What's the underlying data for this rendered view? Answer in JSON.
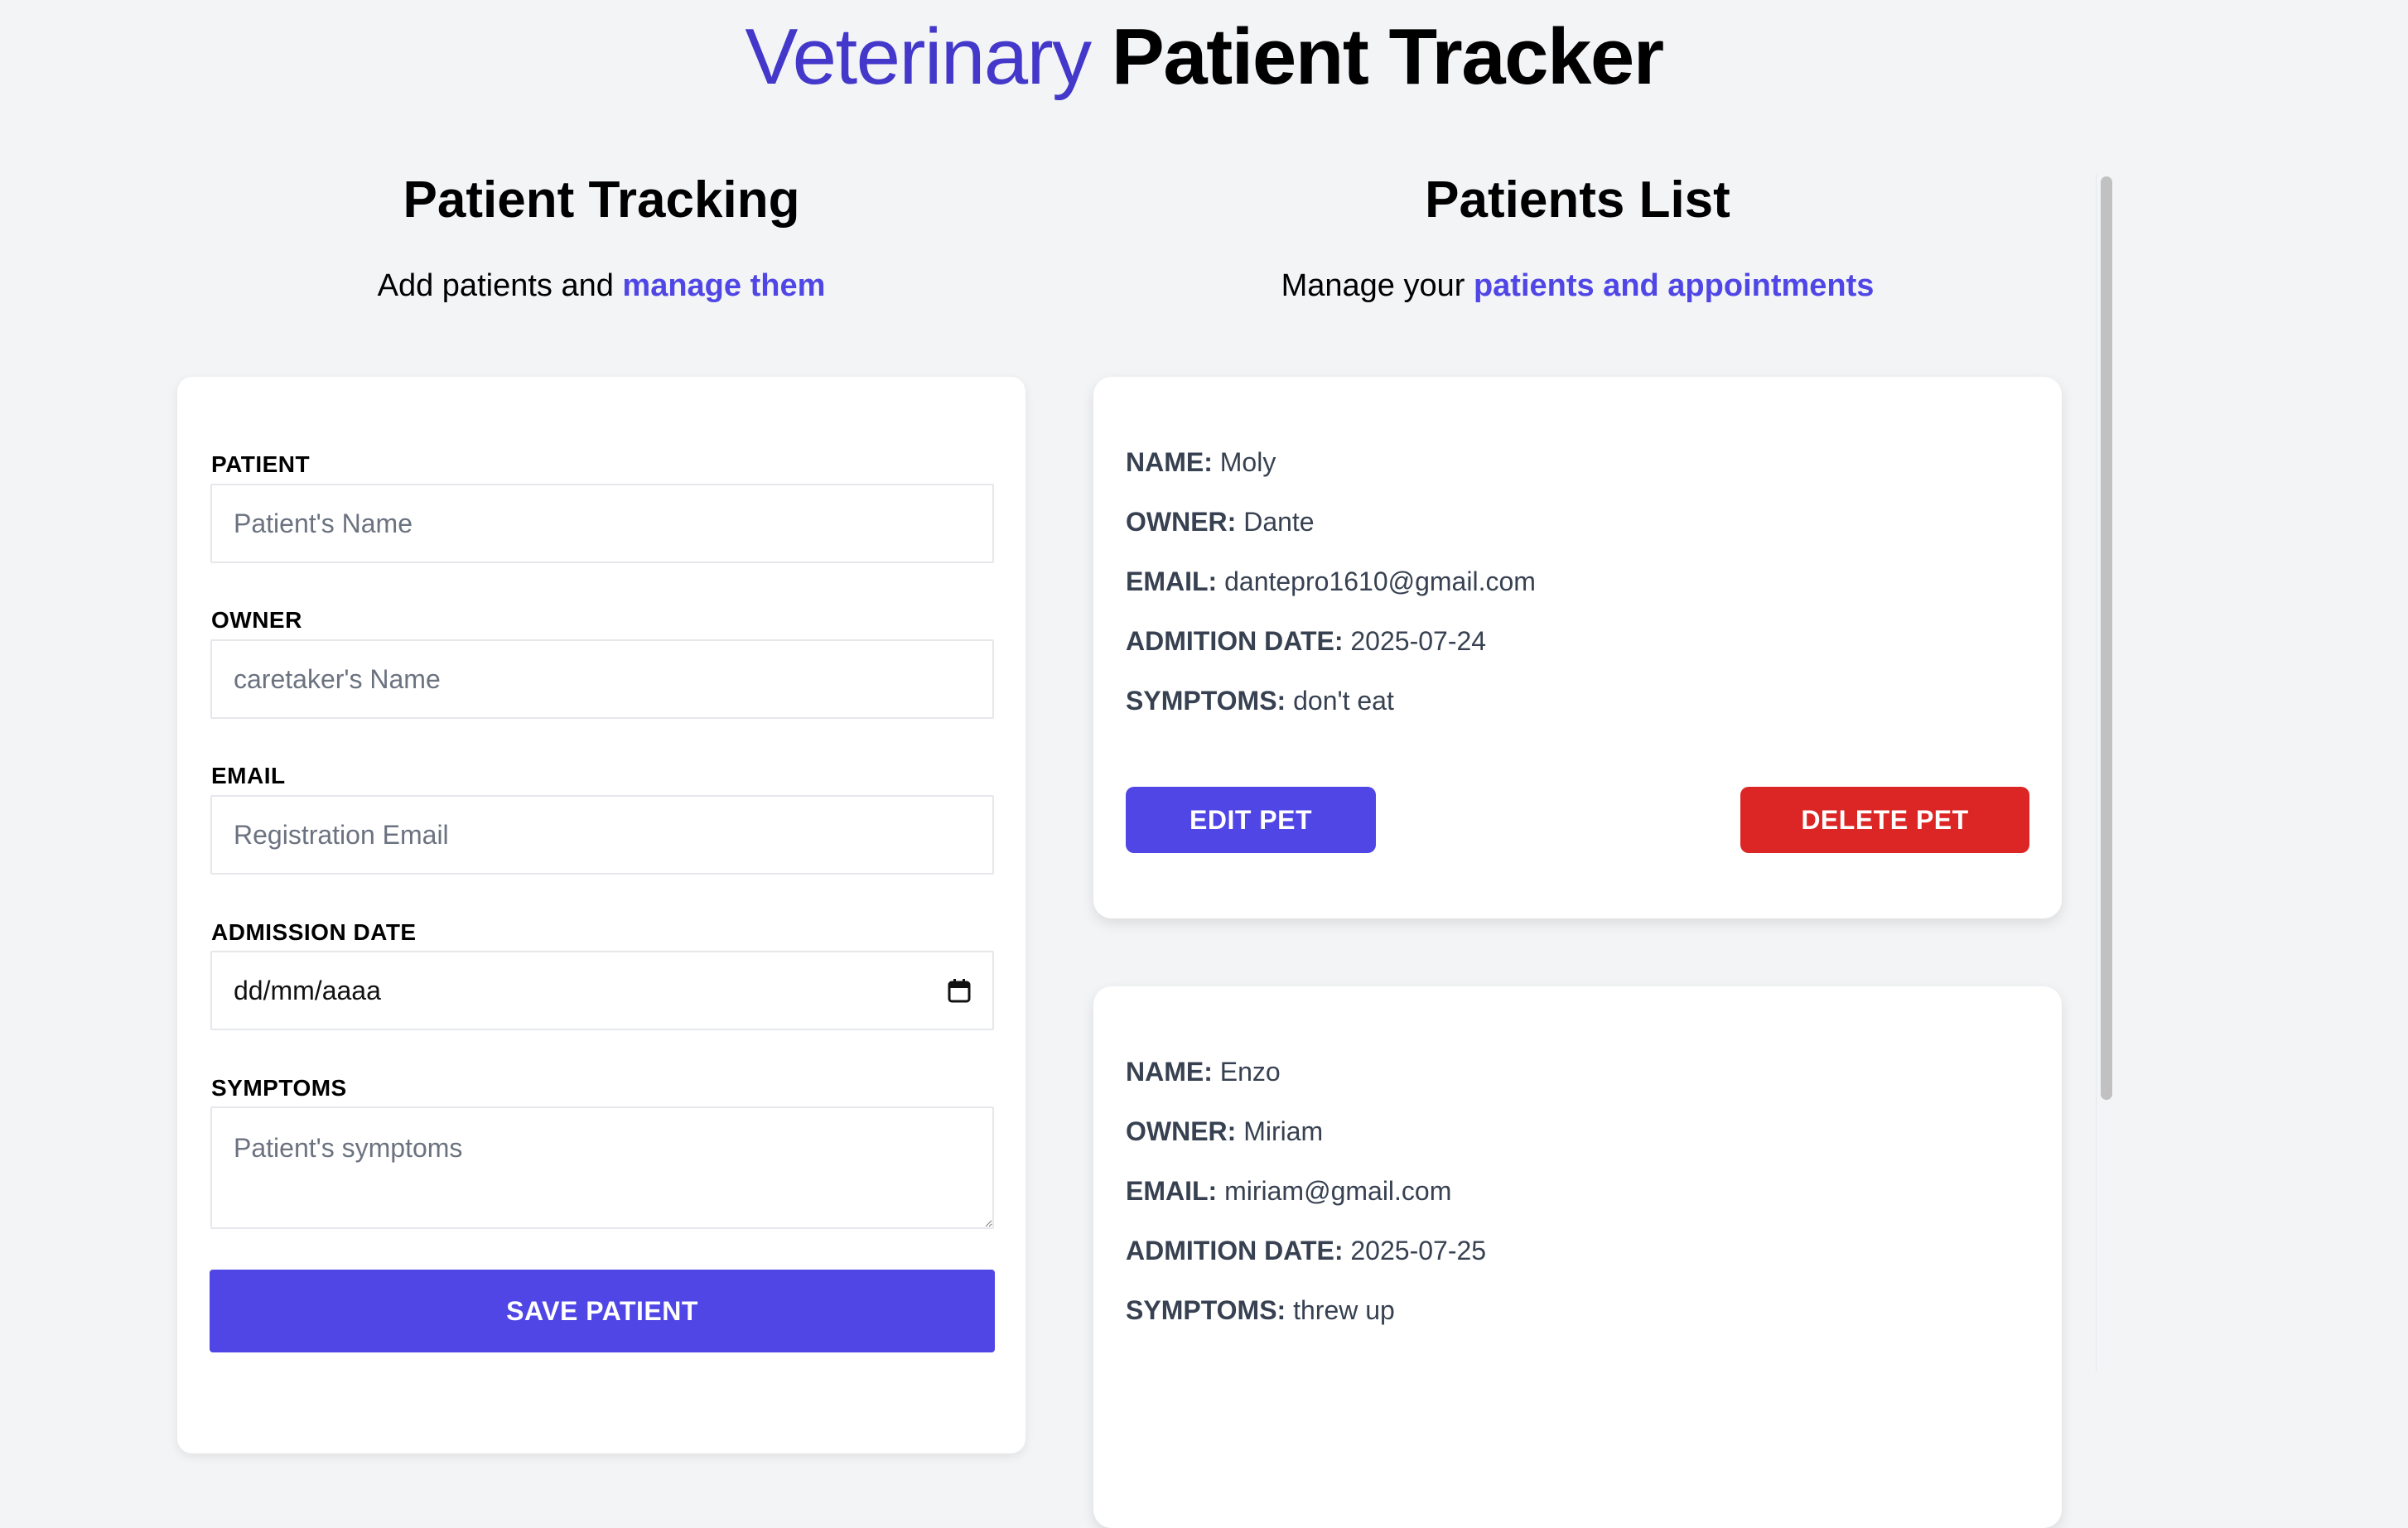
{
  "header": {
    "title_light": "Veterinary",
    "title_bold": "Patient Tracker"
  },
  "form_section": {
    "heading": "Patient Tracking",
    "subtitle_prefix": "Add patients and ",
    "subtitle_highlight": "manage them",
    "fields": {
      "patient": {
        "label": "PATIENT",
        "placeholder": "Patient's Name"
      },
      "owner": {
        "label": "OWNER",
        "placeholder": "caretaker's Name"
      },
      "email": {
        "label": "EMAIL",
        "placeholder": "Registration Email"
      },
      "date": {
        "label": "ADMISSION DATE",
        "placeholder": "dd/mm/aaaa"
      },
      "symptoms": {
        "label": "SYMPTOMS",
        "placeholder": "Patient's symptoms"
      }
    },
    "save_label": "SAVE PATIENT"
  },
  "list_section": {
    "heading": "Patients List",
    "subtitle_prefix": "Manage your ",
    "subtitle_highlight": "patients and appointments",
    "labels": {
      "name": "NAME:",
      "owner": "OWNER:",
      "email": "EMAIL:",
      "date": "ADMITION DATE:",
      "symptoms": "SYMPTOMS:"
    },
    "patients": [
      {
        "name": "Moly",
        "owner": "Dante",
        "email": "dantepro1610@gmail.com",
        "date": "2025-07-24",
        "symptoms": "don't eat"
      },
      {
        "name": "Enzo",
        "owner": "Miriam",
        "email": "miriam@gmail.com",
        "date": "2025-07-25",
        "symptoms": "threw up"
      }
    ],
    "edit_label": "EDIT PET",
    "delete_label": "DELETE PET"
  },
  "colors": {
    "accent": "#4f46e5",
    "title_accent": "#4338ca",
    "danger": "#dc2626",
    "background": "#f3f4f6"
  },
  "icons": {
    "date_picker": "calendar-icon"
  }
}
